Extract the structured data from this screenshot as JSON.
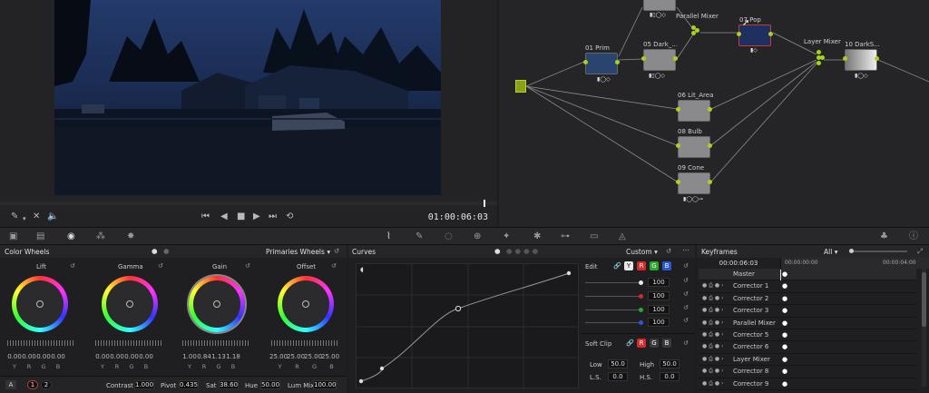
{
  "viewer": {
    "timecode": "01:00:06:03"
  },
  "nodes": {
    "parallel_mixer": "Parallel Mixer",
    "n01_num": "01",
    "n01_label": "Prim",
    "n05_num": "05",
    "n05_label": "Dark_...",
    "n07_num": "07",
    "n07_label": "Pop",
    "n10_num": "10",
    "n10_label": "DarkS...",
    "layer_mixer": "Layer Mixer",
    "n06_num": "06",
    "n06_label": "Lit_Area",
    "n08_num": "08",
    "n08_label": "Bulb",
    "n09_num": "09",
    "n09_label": "Cone"
  },
  "color_wheels": {
    "title": "Color Wheels",
    "mode": "Primaries Wheels",
    "wheels": [
      {
        "name": "Lift",
        "values": [
          "0.00",
          "0.00",
          "0.00",
          "0.00"
        ]
      },
      {
        "name": "Gamma",
        "values": [
          "0.00",
          "0.00",
          "0.00",
          "0.00"
        ]
      },
      {
        "name": "Gain",
        "values": [
          "1.00",
          "0.84",
          "1.13",
          "1.18"
        ]
      },
      {
        "name": "Offset",
        "values": [
          "25.00",
          "25.00",
          "25.00",
          "25.00"
        ]
      }
    ],
    "channel_labels": [
      "Y",
      "R",
      "G",
      "B"
    ],
    "footer": {
      "a_label": "A",
      "page1": "1",
      "page2": "2",
      "contrast_label": "Contrast",
      "contrast": "1.000",
      "pivot_label": "Pivot",
      "pivot": "0.435",
      "sat_label": "Sat",
      "sat": "38.60",
      "hue_label": "Hue",
      "hue": "50.00",
      "lummix_label": "Lum Mix",
      "lummix": "100.00"
    }
  },
  "curves": {
    "title": "Curves",
    "mode": "Custom",
    "edit_label": "Edit",
    "chips": [
      "Y",
      "R",
      "G",
      "B"
    ],
    "intensity": [
      "100",
      "100",
      "100",
      "100"
    ],
    "softclip_label": "Soft Clip",
    "softclip_chips": [
      "R",
      "G",
      "B"
    ],
    "low_label": "Low",
    "low": "50.0",
    "high_label": "High",
    "high": "50.0",
    "ls_label": "L.S.",
    "ls": "0.0",
    "hs_label": "H.S.",
    "hs": "0.0"
  },
  "keyframes": {
    "title": "Keyframes",
    "filter": "All",
    "timecode": "00:00:06:03",
    "ruler_start": "00:00:00:00",
    "ruler_end": "00:00:04:00",
    "rows": [
      "Master",
      "Corrector 1",
      "Corrector 2",
      "Corrector 3",
      "Parallel Mixer",
      "Corrector 5",
      "Corrector 6",
      "Layer Mixer",
      "Corrector 8",
      "Corrector 9"
    ]
  },
  "colors": {
    "accent": "#a8d21e",
    "selected_node": "#c23a3a",
    "chip_y": "#e8e8e8",
    "chip_r": "#d12b2b",
    "chip_g": "#2ea52e",
    "chip_b": "#2b57d1"
  }
}
